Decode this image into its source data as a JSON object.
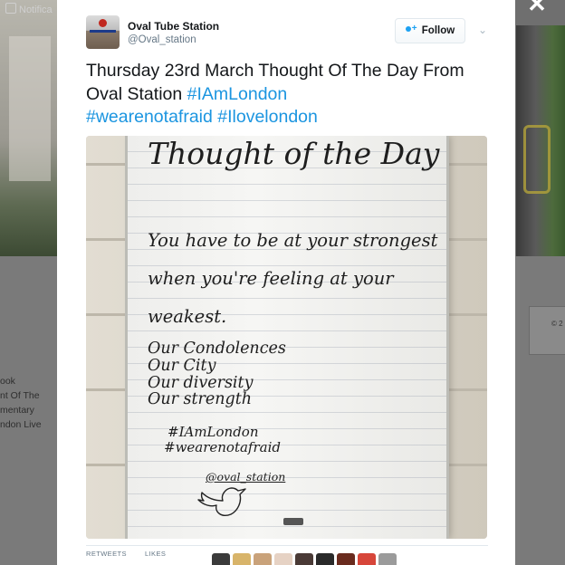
{
  "background": {
    "notifications_label": "Notifica",
    "left_text_lines": [
      "ook",
      "nt Of The",
      "mentary",
      "ndon Live"
    ],
    "right_card_text": "© 2"
  },
  "tweet": {
    "display_name": "Oval Tube Station",
    "screen_name": "@Oval_station",
    "follow_label": "Follow",
    "text_plain": "Thursday 23rd March Thought Of The Day From Oval Station ",
    "hashtags": [
      "#IAmLondon",
      "#wearenotafraid",
      "#Ilovelondon"
    ]
  },
  "whiteboard": {
    "title": "Thought of the Day",
    "lines": [
      "You have to be at your strongest",
      "when you're feeling at your",
      "weakest.",
      "Our Condolences",
      "Our City",
      "Our diversity",
      "Our strength"
    ],
    "tags": [
      "#IAmLondon",
      "#wearenotafraid"
    ],
    "handle": "@oval_station"
  },
  "stats": {
    "retweets_label": "RETWEETS",
    "likes_label": "LIKES"
  },
  "liker_colors": [
    "#3b3b3b",
    "#d8b46a",
    "#c9a27a",
    "#e6d2c4",
    "#4a3a36",
    "#2a2a2a",
    "#6a2b1e",
    "#d7463a",
    "#9b9b9b"
  ],
  "icons": [
    "close-icon",
    "follow-user-icon",
    "chevron-down-icon",
    "bird-icon"
  ]
}
